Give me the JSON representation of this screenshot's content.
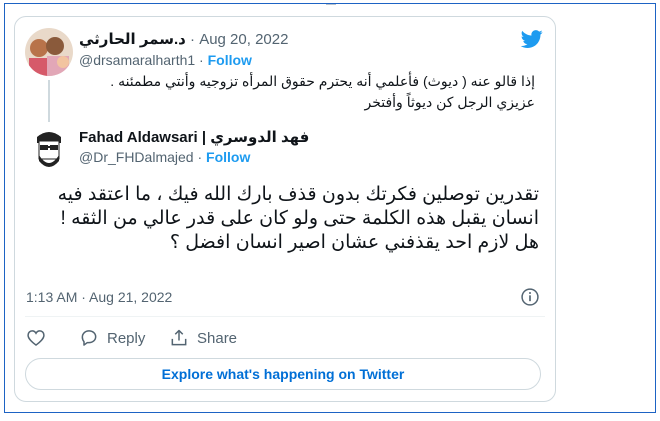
{
  "quoted_tweet": {
    "author_name": "د.سمر الحارثي",
    "date": "Aug 20, 2022",
    "handle": "@drsamaralharth1",
    "follow_label": "Follow",
    "text_line1": "إذا قالو عنه ( ديوث) فأعلمي أنه يحترم حقوق المرأه تزوجيه وأنتي مطمئنه .",
    "text_line2": "عزيزي الرجل كن ديوثاً وأفتخر"
  },
  "reply_tweet": {
    "author_name": "Fahad Aldawsari | فهد الدوسري",
    "handle": "@Dr_FHDalmajed",
    "follow_label": "Follow",
    "text": "تقدرين توصلين فكرتك بدون قذف بارك الله فيك ، ما اعتقد فيه انسان يقبل هذه الكلمة حتى ولو كان على قدر عالي من الثقه ! هل لازم احد يقذفني عشان اصير انسان افضل ؟",
    "timestamp": "1:13 AM · Aug 21, 2022"
  },
  "actions": {
    "reply_label": "Reply",
    "share_label": "Share"
  },
  "explore_button": "Explore what's happening on Twitter",
  "icons": [
    "twitter-bird-icon",
    "info-icon",
    "heart-icon",
    "reply-icon",
    "share-icon"
  ],
  "colors": {
    "twitter_blue": "#1d9bf0",
    "link_blue": "#006fd6",
    "muted": "#536471",
    "border": "#cfd9de",
    "frame": "#1d63c4"
  }
}
